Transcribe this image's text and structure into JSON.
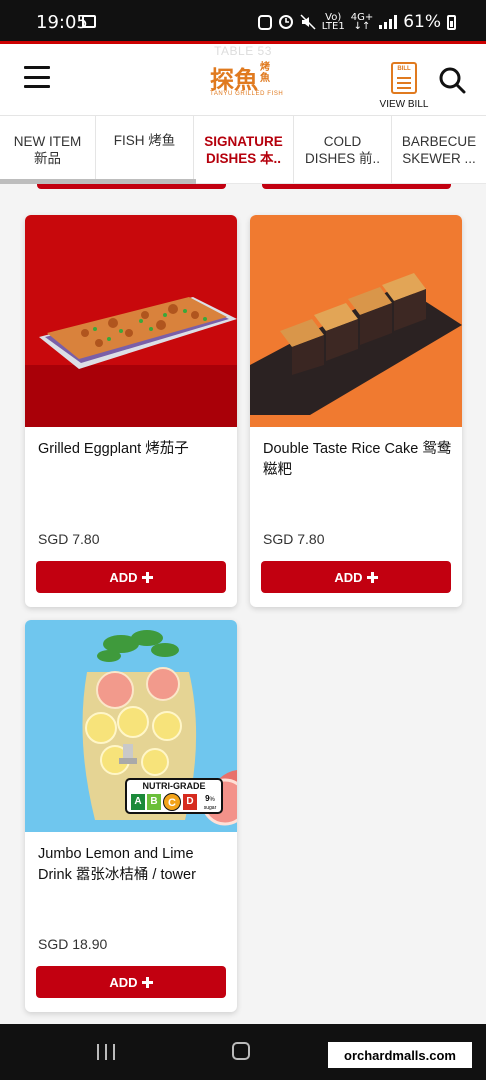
{
  "status_bar": {
    "time": "19:05",
    "network_top": "Vo)",
    "network_bottom": "LTE1",
    "gen_top": "4G+",
    "gen_bottom": "↓↑",
    "battery": "61%"
  },
  "header": {
    "table_label": "TABLE 53",
    "logo_main": "探魚",
    "logo_side": "烤魚",
    "logo_sub": "TANYU GRILLED FISH",
    "bill_tag": "BILL",
    "bill_label": "VIEW BILL"
  },
  "tabs": [
    {
      "line1": "NEW ITEM",
      "line2": "新品"
    },
    {
      "line1": "FISH 烤鱼",
      "line2": ""
    },
    {
      "line1": "SIGNATURE",
      "line2": "DISHES 本.."
    },
    {
      "line1": "COLD",
      "line2": "DISHES 前.."
    },
    {
      "line1": "BARBECUE",
      "line2": "SKEWER ..."
    }
  ],
  "items": [
    {
      "name": "Grilled Eggplant 烤茄子",
      "price": "SGD 7.80",
      "add_label": "ADD"
    },
    {
      "name": "Double Taste Rice Cake 鸳鸯糍粑",
      "price": "SGD 7.80",
      "add_label": "ADD"
    },
    {
      "name": "Jumbo Lemon and Lime Drink 嚣张冰桔桶 / tower",
      "price": "SGD 18.90",
      "add_label": "ADD"
    }
  ],
  "nutri_grade": {
    "title": "NUTRI-GRADE",
    "grades": [
      "A",
      "B",
      "C",
      "D"
    ],
    "selected": "C",
    "sugar_value": "9",
    "sugar_unit": "%",
    "sugar_label": "sugar"
  },
  "watermark": "orchardmalls.com",
  "colors": {
    "accent": "#c20010",
    "brand": "#e07a1f"
  }
}
